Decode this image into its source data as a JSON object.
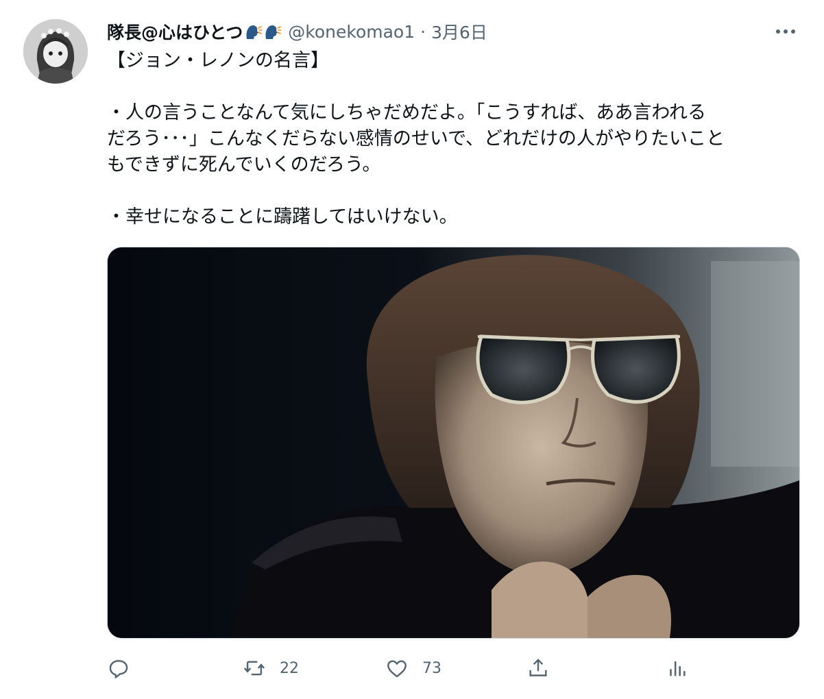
{
  "user": {
    "display_name": "隊長@心はひとつ",
    "name_emojis": [
      "speaking-head-emoji",
      "speaking-head-emoji"
    ],
    "handle": "@konekomao1",
    "separator": "·",
    "date": "3月6日"
  },
  "tweet": {
    "title_line": "【ジョン・レノンの名言】",
    "paragraph1": [
      "・人の言うことなんて気にしちゃだめだよ。「こうすれば、ああ言われる",
      "だろう･･･」こんなくだらない感情のせいで、どれだけの人がやりたいこと",
      "もできずに死んでいくのだろう。"
    ],
    "paragraph2": "・幸せになることに躊躇してはいけない。"
  },
  "actions": {
    "reply_icon": "reply-icon",
    "retweet_icon": "retweet-icon",
    "retweet_count": "22",
    "like_icon": "heart-icon",
    "like_count": "73",
    "share_icon": "share-icon",
    "analytics_icon": "analytics-icon"
  },
  "colors": {
    "text": "#0f1419",
    "secondary_text": "#536471",
    "border": "#cfd9de"
  }
}
